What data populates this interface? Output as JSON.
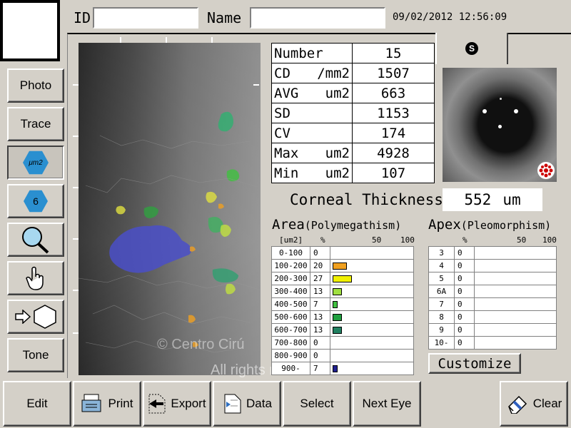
{
  "header": {
    "id_label": "ID",
    "id_value": "",
    "name_label": "Name",
    "name_value": "",
    "datetime": "09/02/2012 12:56:09"
  },
  "tab": {
    "label": "S"
  },
  "sidebar": {
    "photo": "Photo",
    "trace": "Trace",
    "um2": "μm2",
    "six": "6",
    "tone": "Tone"
  },
  "stats": [
    {
      "label": "Number",
      "unit": "",
      "value": "15"
    },
    {
      "label": "CD",
      "unit": "/mm2",
      "value": "1507"
    },
    {
      "label": "AVG",
      "unit": "um2",
      "value": "663"
    },
    {
      "label": "SD",
      "unit": "",
      "value": "1153"
    },
    {
      "label": "CV",
      "unit": "",
      "value": "174"
    },
    {
      "label": "Max",
      "unit": "um2",
      "value": "4928"
    },
    {
      "label": "Min",
      "unit": "um2",
      "value": "107"
    }
  ],
  "corneal": {
    "label": "Corneal Thickness",
    "value": "552",
    "unit": "um"
  },
  "area": {
    "title": "Area",
    "subtitle": "(Polymegathism)",
    "col_unit": "[um2]",
    "col_pct": "%",
    "tick50": "50",
    "tick100": "100",
    "rows": [
      {
        "label": "0-100",
        "pct": "0",
        "value": 0,
        "color": ""
      },
      {
        "label": "100-200",
        "pct": "20",
        "value": 20,
        "color": "#f0a020"
      },
      {
        "label": "200-300",
        "pct": "27",
        "value": 27,
        "color": "#f0f000"
      },
      {
        "label": "300-400",
        "pct": "13",
        "value": 13,
        "color": "#a0e040"
      },
      {
        "label": "400-500",
        "pct": "7",
        "value": 7,
        "color": "#40c040"
      },
      {
        "label": "500-600",
        "pct": "13",
        "value": 13,
        "color": "#20a040"
      },
      {
        "label": "600-700",
        "pct": "13",
        "value": 13,
        "color": "#208060"
      },
      {
        "label": "700-800",
        "pct": "0",
        "value": 0,
        "color": ""
      },
      {
        "label": "800-900",
        "pct": "0",
        "value": 0,
        "color": ""
      },
      {
        "label": "900-",
        "pct": "7",
        "value": 7,
        "color": "#202090"
      }
    ]
  },
  "apex": {
    "title": "Apex",
    "subtitle": "(Pleomorphism)",
    "col_pct": "%",
    "tick50": "50",
    "tick100": "100",
    "rows": [
      {
        "label": "3",
        "pct": "0"
      },
      {
        "label": "4",
        "pct": "0"
      },
      {
        "label": "5",
        "pct": "0"
      },
      {
        "label": "6A",
        "pct": "0"
      },
      {
        "label": "7",
        "pct": "0"
      },
      {
        "label": "8",
        "pct": "0"
      },
      {
        "label": "9",
        "pct": "0"
      },
      {
        "label": "10-",
        "pct": "0"
      }
    ]
  },
  "customize": "Customize",
  "watermark": {
    "line1": "© Centro Cirú",
    "line2": "All rights reserved"
  },
  "bottom": {
    "edit": "Edit",
    "print": "Print",
    "export": "Export",
    "data": "Data",
    "select": "Select",
    "next_eye": "Next Eye",
    "clear": "Clear"
  }
}
